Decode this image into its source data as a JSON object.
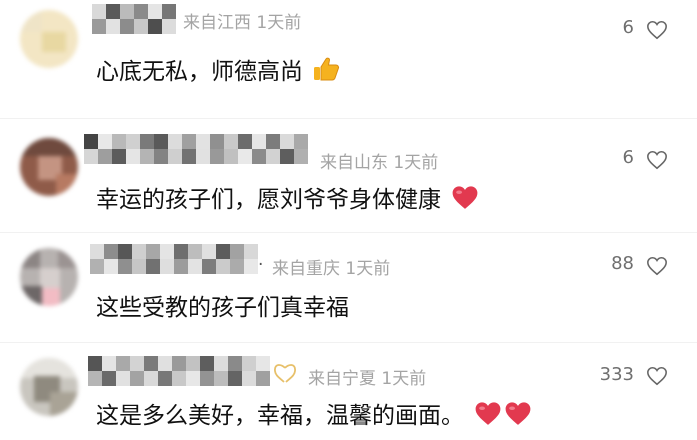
{
  "comments": [
    {
      "location_time": "来自江西 1天前",
      "likes": "6",
      "text": "心底无私，师德高尚",
      "emoji": "thumbs-up"
    },
    {
      "location_time": "来自山东 1天前",
      "likes": "6",
      "text": "幸运的孩子们，愿刘爷爷身体健康",
      "emoji": "red-heart"
    },
    {
      "location_time": "来自重庆 1天前",
      "likes": "88",
      "text": "这些受教的孩子们真幸福",
      "name_suffix": "."
    },
    {
      "location_time": "来自宁夏 1天前",
      "likes": "333",
      "text": "这是多么美好，幸福，温馨的画面。",
      "emoji": "two-red-hearts"
    }
  ],
  "colors": {
    "meta_gray": "#a4a4a4",
    "heart_red": "#e2394f",
    "thumb_yellow": "#f5b21f"
  }
}
